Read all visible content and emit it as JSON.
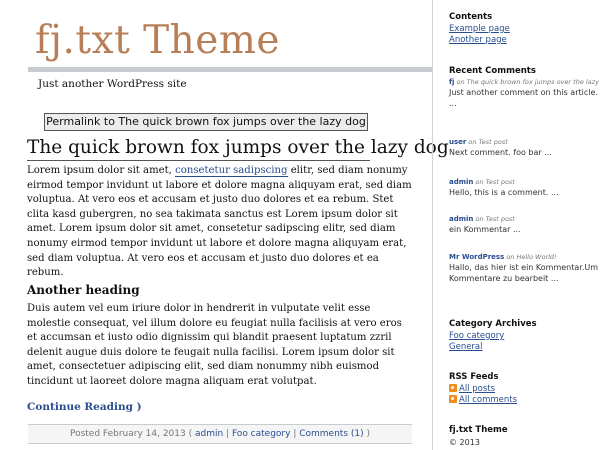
{
  "site": {
    "title": "fj.txt Theme",
    "tagline": "Just another WordPress site"
  },
  "post": {
    "permalink_tooltip": "Permalink to The quick brown fox jumps over the lazy dog",
    "title": "The quick brown fox jumps over the lazy dog",
    "para1_before": "Lorem ipsum dolor sit amet, ",
    "para1_link": "consetetur sadipscing",
    "para1_after": " elitr, sed diam nonumy eirmod tempor invidunt ut labore et dolore magna aliquyam erat, sed diam voluptua. At vero eos et accusam et justo duo dolores et ea rebum. Stet clita kasd gubergren, no sea takimata sanctus est Lorem ipsum dolor sit amet. Lorem ipsum dolor sit amet, consetetur sadipscing elitr, sed diam nonumy eirmod tempor invidunt ut labore et dolore magna aliquyam erat, sed diam voluptua. At vero eos et accusam et justo duo dolores et ea rebum.",
    "heading2": "Another heading",
    "para2": "Duis autem vel eum iriure dolor in hendrerit in vulputate velit esse molestie consequat, vel illum dolore eu feugiat nulla facilisis at vero eros et accumsan et iusto odio dignissim qui blandit praesent luptatum zzril delenit augue duis dolore te feugait nulla facilisi. Lorem ipsum dolor sit amet, consectetuer adipiscing elit, sed diam nonummy nibh euismod tincidunt ut laoreet dolore magna aliquam erat volutpat.",
    "continue_label": "Continue Reading )",
    "meta_posted": "Posted February 14, 2013 (",
    "meta_author": "admin",
    "meta_sep1": " | ",
    "meta_category": "Foo category",
    "meta_sep2": " | ",
    "meta_comments": "Comments (1)",
    "meta_end": " )"
  },
  "sidebar": {
    "contents": {
      "title": "Contents",
      "links": [
        "Example page",
        "Another page"
      ]
    },
    "recent_comments": {
      "title": "Recent Comments",
      "items": [
        {
          "author": "fj",
          "on": " on The quick brown fox jumps over the lazy dog",
          "text": "Just another comment on this article. ..."
        },
        {
          "author": "user",
          "on": " on Test post",
          "text": "Next comment. foo bar ..."
        },
        {
          "author": "admin",
          "on": " on Test post",
          "text": "Hello, this is a comment. ..."
        },
        {
          "author": "admin",
          "on": " on Test post",
          "text": "ein Kommentar ..."
        },
        {
          "author": "Mr WordPress",
          "on": " on Hello World!",
          "text": "Hallo, das hier ist ein Kommentar.Um Kommentare zu bearbeit ..."
        }
      ]
    },
    "category_archives": {
      "title": "Category Archives",
      "links": [
        "Foo category",
        "General"
      ]
    },
    "rss": {
      "title": "RSS Feeds",
      "links": [
        "All posts",
        "All comments"
      ]
    },
    "theme_info": {
      "title": "fj.txt Theme",
      "copyright": "© 2013"
    }
  }
}
